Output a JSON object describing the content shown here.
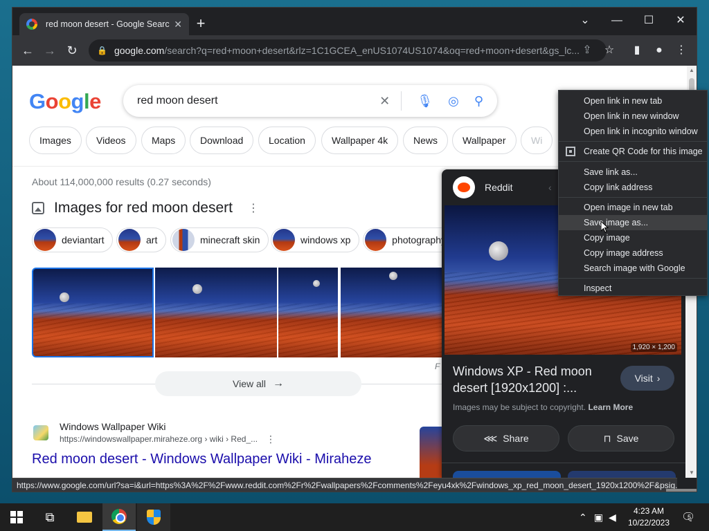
{
  "browser": {
    "tab_title": "red moon desert - Google Searc",
    "url_host": "google.com",
    "url_rest": "/search?q=red+moon+desert&rlz=1C1GCEA_enUS1074US1074&oq=red+moon+desert&gs_lc...",
    "status_url": "https://www.google.com/url?sa=i&url=https%3A%2F%2Fwww.reddit.com%2Fr%2Fwallpapers%2Fcomments%2Feyu4xk%2Fwindows_xp_red_moon_desert_1920x1200%2F&psig..."
  },
  "google": {
    "logo": "Google",
    "query": "red moon desert",
    "chips": [
      "Images",
      "Videos",
      "Maps",
      "Download",
      "Location",
      "Wallpaper 4k",
      "News",
      "Wallpaper",
      "Wi"
    ],
    "result_stats": "About 114,000,000 results (0.27 seconds)",
    "images_header": "Images for red moon desert",
    "pills": [
      "deviantart",
      "art",
      "minecraft skin",
      "windows xp",
      "photography"
    ],
    "view_all": "View all",
    "f_caption": "F",
    "result": {
      "site": "Windows Wallpaper Wiki",
      "url": "https://windowswallpaper.miraheze.org › wiki › Red_...",
      "title": "Red moon desert - Windows Wallpaper Wiki - Miraheze"
    }
  },
  "panel": {
    "source": "Reddit",
    "dimensions": "1,920 × 1,200",
    "title": "Windows XP - Red moon desert [1920x1200] :...",
    "visit": "Visit",
    "copyright": "Images may be subject to copyright.",
    "learn_more": "Learn More",
    "share": "Share",
    "save": "Save"
  },
  "context_menu": {
    "items": [
      "Open link in new tab",
      "Open link in new window",
      "Open link in incognito window",
      "Create QR Code for this image",
      "Save link as...",
      "Copy link address",
      "Open image in new tab",
      "Save image as...",
      "Copy image",
      "Copy image address",
      "Search image with Google",
      "Inspect"
    ],
    "highlighted": "Save image as..."
  },
  "taskbar": {
    "time": "4:23 AM",
    "date": "10/22/2023",
    "notification_count": "5"
  },
  "icons": {
    "back": "back-arrow-icon",
    "forward": "forward-arrow-icon",
    "reload": "reload-icon",
    "share": "share-icon",
    "bookmark": "star-icon",
    "profile": "profile-icon",
    "menu": "kebab-menu-icon"
  }
}
